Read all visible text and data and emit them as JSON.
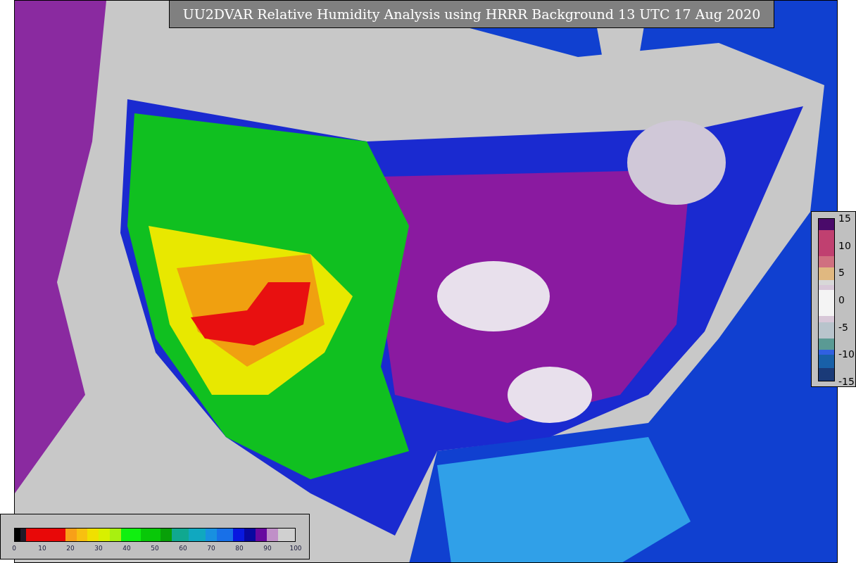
{
  "title": "UU2DVAR Relative Humidity Analysis using HRRR Background 13 UTC 17 Aug 2020",
  "humidity_colorbar": {
    "ticks": [
      "0",
      "10",
      "20",
      "30",
      "40",
      "50",
      "60",
      "70",
      "80",
      "90",
      "100"
    ]
  },
  "difference_colorbar": {
    "ticks": [
      "15",
      "10",
      "5",
      "0",
      "-5",
      "-10",
      "-15"
    ]
  }
}
